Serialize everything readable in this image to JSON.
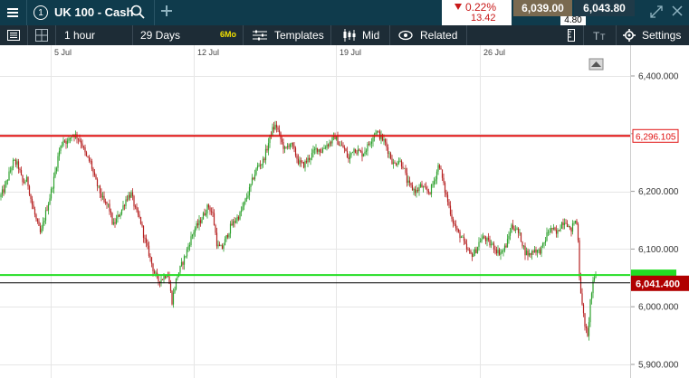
{
  "header": {
    "menu_icon": "hamburger-icon",
    "instrument_badge": "1",
    "instrument_name": "UK 100 - Cash",
    "search_icon": "search-icon",
    "add_icon": "plus-icon",
    "change_percent": "0.22%",
    "change_points": "13.42",
    "change_direction_icon": "down-triangle-icon",
    "sell_price": "6,039.00",
    "buy_price": "6,043.80",
    "spread": "4.80",
    "collapse_icon": "diagonal-arrows-icon",
    "close_icon": "close-icon"
  },
  "toolbar": {
    "list_icon": "list-icon",
    "layout_icon": "grid-layout-icon",
    "interval": "1 hour",
    "range": "29 Days",
    "range_badge": "6Mo",
    "templates_label": "Templates",
    "price_type": "Mid",
    "related_label": "Related",
    "settings_label": "Settings",
    "text_icon": "text-size-icon",
    "ruler_icon": "ruler-icon",
    "settings_icon": "gear-icon"
  },
  "colors": {
    "up": "#2ca02c",
    "down": "#b51f1f",
    "resistance": "#e01010",
    "support": "#22dd22",
    "current": "#b00000"
  },
  "chart_data": {
    "type": "candlestick",
    "x_labels": [
      "5 Jul",
      "12 Jul",
      "19 Jul",
      "26 Jul"
    ],
    "y_ticks": [
      "6,400.000",
      "6,300.000",
      "6,200.000",
      "6,100.000",
      "6,000.000",
      "5,900.000"
    ],
    "ylim": [
      5880,
      6440
    ],
    "grid": true,
    "horizontal_lines": [
      {
        "label": "6,296.105",
        "value": 6296.105,
        "color": "#e01010"
      },
      {
        "label": "",
        "value": 6055,
        "color": "#22dd22"
      },
      {
        "label": "6,041.400",
        "value": 6041.4,
        "color": "#000000"
      }
    ],
    "current_price_label": "6,041.400",
    "price_path_anchors": [
      [
        0,
        6190
      ],
      [
        5,
        6205
      ],
      [
        10,
        6230
      ],
      [
        15,
        6252
      ],
      [
        20,
        6245
      ],
      [
        25,
        6215
      ],
      [
        30,
        6220
      ],
      [
        35,
        6180
      ],
      [
        40,
        6150
      ],
      [
        45,
        6125
      ],
      [
        50,
        6160
      ],
      [
        55,
        6190
      ],
      [
        60,
        6225
      ],
      [
        65,
        6268
      ],
      [
        70,
        6290
      ],
      [
        75,
        6285
      ],
      [
        80,
        6300
      ],
      [
        85,
        6295
      ],
      [
        90,
        6285
      ],
      [
        95,
        6260
      ],
      [
        100,
        6250
      ],
      [
        105,
        6220
      ],
      [
        110,
        6200
      ],
      [
        115,
        6180
      ],
      [
        120,
        6175
      ],
      [
        125,
        6140
      ],
      [
        130,
        6155
      ],
      [
        135,
        6170
      ],
      [
        140,
        6190
      ],
      [
        145,
        6195
      ],
      [
        150,
        6165
      ],
      [
        155,
        6150
      ],
      [
        160,
        6115
      ],
      [
        165,
        6090
      ],
      [
        170,
        6060
      ],
      [
        175,
        6045
      ],
      [
        180,
        6050
      ],
      [
        185,
        6060
      ],
      [
        190,
        6010
      ],
      [
        195,
        6050
      ],
      [
        200,
        6070
      ],
      [
        205,
        6090
      ],
      [
        210,
        6115
      ],
      [
        215,
        6135
      ],
      [
        220,
        6145
      ],
      [
        225,
        6160
      ],
      [
        230,
        6175
      ],
      [
        235,
        6160
      ],
      [
        240,
        6105
      ],
      [
        245,
        6100
      ],
      [
        250,
        6120
      ],
      [
        255,
        6140
      ],
      [
        260,
        6150
      ],
      [
        265,
        6160
      ],
      [
        270,
        6180
      ],
      [
        275,
        6200
      ],
      [
        280,
        6225
      ],
      [
        285,
        6245
      ],
      [
        290,
        6250
      ],
      [
        295,
        6275
      ],
      [
        300,
        6305
      ],
      [
        305,
        6315
      ],
      [
        310,
        6290
      ],
      [
        315,
        6270
      ],
      [
        320,
        6285
      ],
      [
        325,
        6270
      ],
      [
        330,
        6250
      ],
      [
        335,
        6245
      ],
      [
        340,
        6255
      ],
      [
        345,
        6265
      ],
      [
        350,
        6275
      ],
      [
        355,
        6270
      ],
      [
        360,
        6280
      ],
      [
        365,
        6285
      ],
      [
        370,
        6295
      ],
      [
        375,
        6280
      ],
      [
        380,
        6275
      ],
      [
        385,
        6255
      ],
      [
        390,
        6275
      ],
      [
        395,
        6270
      ],
      [
        400,
        6265
      ],
      [
        405,
        6275
      ],
      [
        410,
        6290
      ],
      [
        415,
        6305
      ],
      [
        420,
        6295
      ],
      [
        425,
        6285
      ],
      [
        430,
        6265
      ],
      [
        435,
        6245
      ],
      [
        440,
        6255
      ],
      [
        445,
        6245
      ],
      [
        450,
        6215
      ],
      [
        455,
        6205
      ],
      [
        460,
        6200
      ],
      [
        465,
        6210
      ],
      [
        470,
        6200
      ],
      [
        475,
        6200
      ],
      [
        480,
        6220
      ],
      [
        485,
        6250
      ],
      [
        490,
        6210
      ],
      [
        495,
        6180
      ],
      [
        500,
        6150
      ],
      [
        505,
        6130
      ],
      [
        510,
        6120
      ],
      [
        515,
        6100
      ],
      [
        520,
        6090
      ],
      [
        525,
        6095
      ],
      [
        530,
        6115
      ],
      [
        535,
        6120
      ],
      [
        540,
        6110
      ],
      [
        545,
        6105
      ],
      [
        550,
        6095
      ],
      [
        555,
        6095
      ],
      [
        560,
        6110
      ],
      [
        565,
        6140
      ],
      [
        570,
        6135
      ],
      [
        575,
        6120
      ],
      [
        580,
        6095
      ],
      [
        585,
        6090
      ],
      [
        590,
        6100
      ],
      [
        595,
        6095
      ],
      [
        600,
        6105
      ],
      [
        605,
        6130
      ],
      [
        610,
        6135
      ],
      [
        615,
        6125
      ],
      [
        620,
        6145
      ],
      [
        625,
        6150
      ],
      [
        630,
        6130
      ],
      [
        635,
        6150
      ],
      [
        638,
        6140
      ],
      [
        640,
        6055
      ],
      [
        643,
        6000
      ],
      [
        646,
        5970
      ],
      [
        649,
        5945
      ],
      [
        652,
        6010
      ],
      [
        655,
        6040
      ],
      [
        658,
        6055
      ]
    ]
  }
}
